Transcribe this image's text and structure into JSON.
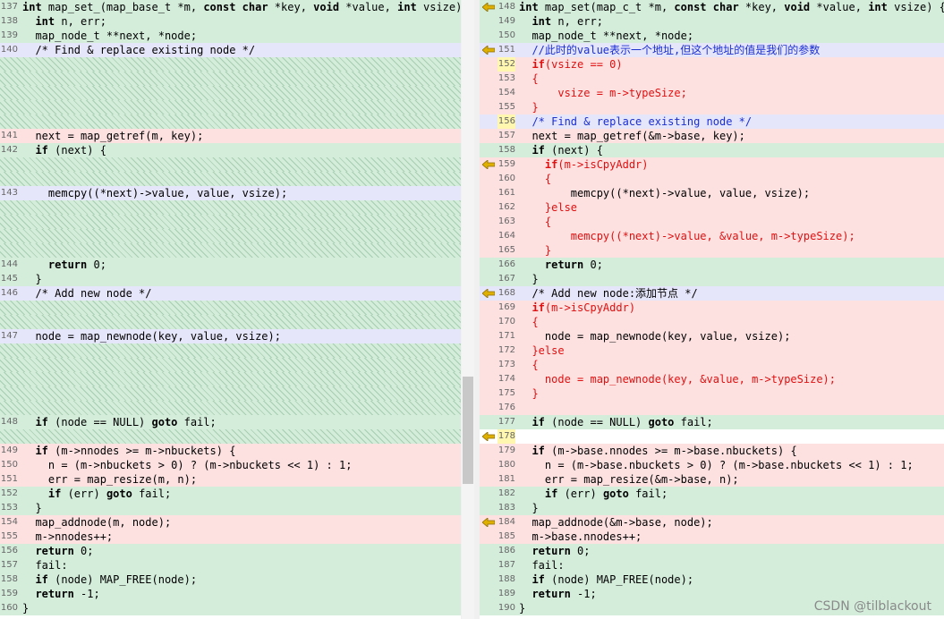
{
  "left": {
    "lines": [
      {
        "n": "137",
        "t": "int map_set_(map_base_t *m, const char *key, void *value, int vsize) {",
        "c": "same"
      },
      {
        "n": "138",
        "t": "  int n, err;",
        "c": "same"
      },
      {
        "n": "139",
        "t": "  map_node_t **next, *node;",
        "c": "same"
      },
      {
        "n": "140",
        "t": "  /* Find & replace existing node */",
        "c": "comment"
      },
      {
        "n": "",
        "t": "",
        "c": "hatch"
      },
      {
        "n": "",
        "t": "",
        "c": "hatch"
      },
      {
        "n": "",
        "t": "",
        "c": "hatch"
      },
      {
        "n": "",
        "t": "",
        "c": "hatch"
      },
      {
        "n": "",
        "t": "",
        "c": "hatch"
      },
      {
        "n": "141",
        "t": "  next = map_getref(m, key);",
        "c": "change"
      },
      {
        "n": "142",
        "t": "  if (next) {",
        "c": "same"
      },
      {
        "n": "",
        "t": "",
        "c": "hatch"
      },
      {
        "n": "",
        "t": "",
        "c": "hatch"
      },
      {
        "n": "143",
        "t": "    memcpy((*next)->value, value, vsize);",
        "c": "comment"
      },
      {
        "n": "",
        "t": "",
        "c": "hatch"
      },
      {
        "n": "",
        "t": "",
        "c": "hatch"
      },
      {
        "n": "",
        "t": "",
        "c": "hatch"
      },
      {
        "n": "",
        "t": "",
        "c": "hatch"
      },
      {
        "n": "144",
        "t": "    return 0;",
        "c": "same"
      },
      {
        "n": "145",
        "t": "  }",
        "c": "same"
      },
      {
        "n": "146",
        "t": "  /* Add new node */",
        "c": "comment"
      },
      {
        "n": "",
        "t": "",
        "c": "hatch"
      },
      {
        "n": "",
        "t": "",
        "c": "hatch"
      },
      {
        "n": "147",
        "t": "  node = map_newnode(key, value, vsize);",
        "c": "comment"
      },
      {
        "n": "",
        "t": "",
        "c": "hatch"
      },
      {
        "n": "",
        "t": "",
        "c": "hatch"
      },
      {
        "n": "",
        "t": "",
        "c": "hatch"
      },
      {
        "n": "",
        "t": "",
        "c": "hatch"
      },
      {
        "n": "",
        "t": "",
        "c": "hatch"
      },
      {
        "n": "148",
        "t": "  if (node == NULL) goto fail;",
        "c": "same"
      },
      {
        "n": "",
        "t": "",
        "c": "hatch"
      },
      {
        "n": "149",
        "t": "  if (m->nnodes >= m->nbuckets) {",
        "c": "change"
      },
      {
        "n": "150",
        "t": "    n = (m->nbuckets > 0) ? (m->nbuckets << 1) : 1;",
        "c": "change"
      },
      {
        "n": "151",
        "t": "    err = map_resize(m, n);",
        "c": "change"
      },
      {
        "n": "152",
        "t": "    if (err) goto fail;",
        "c": "same"
      },
      {
        "n": "153",
        "t": "  }",
        "c": "same"
      },
      {
        "n": "154",
        "t": "  map_addnode(m, node);",
        "c": "change"
      },
      {
        "n": "155",
        "t": "  m->nnodes++;",
        "c": "change"
      },
      {
        "n": "156",
        "t": "  return 0;",
        "c": "same"
      },
      {
        "n": "157",
        "t": "  fail:",
        "c": "same"
      },
      {
        "n": "158",
        "t": "  if (node) MAP_FREE(node);",
        "c": "same"
      },
      {
        "n": "159",
        "t": "  return -1;",
        "c": "same"
      },
      {
        "n": "160",
        "t": "}",
        "c": "same"
      }
    ]
  },
  "right": {
    "lines": [
      {
        "n": "148",
        "t": "int map_set(map_c_t *m, const char *key, void *value, int vsize) {",
        "c": "same",
        "a": true
      },
      {
        "n": "149",
        "t": "  int n, err;",
        "c": "same"
      },
      {
        "n": "150",
        "t": "  map_node_t **next, *node;",
        "c": "same"
      },
      {
        "n": "151",
        "t": "  //此时的value表示一个地址,但这个地址的值是我们的参数",
        "c": "comment",
        "a": true,
        "col": "blue"
      },
      {
        "n": "152",
        "t": "  if(vsize == 0)",
        "c": "change",
        "col": "red",
        "hl": true
      },
      {
        "n": "153",
        "t": "  {",
        "c": "change",
        "col": "red"
      },
      {
        "n": "154",
        "t": "      vsize = m->typeSize;",
        "c": "change",
        "col": "red"
      },
      {
        "n": "155",
        "t": "  }",
        "c": "change",
        "col": "red"
      },
      {
        "n": "156",
        "t": "  /* Find & replace existing node */",
        "c": "comment",
        "col": "blue",
        "hl": true
      },
      {
        "n": "157",
        "t": "  next = map_getref(&m->base, key);",
        "c": "change"
      },
      {
        "n": "158",
        "t": "  if (next) {",
        "c": "same"
      },
      {
        "n": "159",
        "t": "    if(m->isCpyAddr)",
        "c": "change",
        "a": true,
        "col": "red"
      },
      {
        "n": "160",
        "t": "    {",
        "c": "change",
        "col": "red"
      },
      {
        "n": "161",
        "t": "        memcpy((*next)->value, value, vsize);",
        "c": "change"
      },
      {
        "n": "162",
        "t": "    }else",
        "c": "change",
        "col": "red"
      },
      {
        "n": "163",
        "t": "    {",
        "c": "change",
        "col": "red"
      },
      {
        "n": "164",
        "t": "        memcpy((*next)->value, &value, m->typeSize);",
        "c": "change",
        "col": "red"
      },
      {
        "n": "165",
        "t": "    }",
        "c": "change",
        "col": "red"
      },
      {
        "n": "166",
        "t": "    return 0;",
        "c": "same"
      },
      {
        "n": "167",
        "t": "  }",
        "c": "same"
      },
      {
        "n": "168",
        "t": "  /* Add new node:添加节点 */",
        "c": "comment",
        "a": true
      },
      {
        "n": "169",
        "t": "  if(m->isCpyAddr)",
        "c": "change",
        "col": "red"
      },
      {
        "n": "170",
        "t": "  {",
        "c": "change",
        "col": "red"
      },
      {
        "n": "171",
        "t": "    node = map_newnode(key, value, vsize);",
        "c": "change"
      },
      {
        "n": "172",
        "t": "  }else",
        "c": "change",
        "col": "red"
      },
      {
        "n": "173",
        "t": "  {",
        "c": "change",
        "col": "red"
      },
      {
        "n": "174",
        "t": "    node = map_newnode(key, &value, m->typeSize);",
        "c": "change",
        "col": "red"
      },
      {
        "n": "175",
        "t": "  }",
        "c": "change",
        "col": "red"
      },
      {
        "n": "176",
        "t": "",
        "c": "change"
      },
      {
        "n": "177",
        "t": "  if (node == NULL) goto fail;",
        "c": "same"
      },
      {
        "n": "178",
        "t": "",
        "c": "empty",
        "a": true,
        "hl": true
      },
      {
        "n": "179",
        "t": "  if (m->base.nnodes >= m->base.nbuckets) {",
        "c": "change"
      },
      {
        "n": "180",
        "t": "    n = (m->base.nbuckets > 0) ? (m->base.nbuckets << 1) : 1;",
        "c": "change"
      },
      {
        "n": "181",
        "t": "    err = map_resize(&m->base, n);",
        "c": "change"
      },
      {
        "n": "182",
        "t": "    if (err) goto fail;",
        "c": "same"
      },
      {
        "n": "183",
        "t": "  }",
        "c": "same"
      },
      {
        "n": "184",
        "t": "  map_addnode(&m->base, node);",
        "c": "change",
        "a": true
      },
      {
        "n": "185",
        "t": "  m->base.nnodes++;",
        "c": "change"
      },
      {
        "n": "186",
        "t": "  return 0;",
        "c": "same"
      },
      {
        "n": "187",
        "t": "  fail:",
        "c": "same"
      },
      {
        "n": "188",
        "t": "  if (node) MAP_FREE(node);",
        "c": "same"
      },
      {
        "n": "189",
        "t": "  return -1;",
        "c": "same"
      },
      {
        "n": "190",
        "t": "}",
        "c": "same"
      }
    ]
  },
  "watermark": "CSDN @tilblackout",
  "colors": {
    "same": "#d4eddb",
    "change": "#fde1e1",
    "comment": "#e6e6fb",
    "red": "#e01010",
    "blue": "#1a2fd0",
    "arrow": "#e0b000"
  }
}
